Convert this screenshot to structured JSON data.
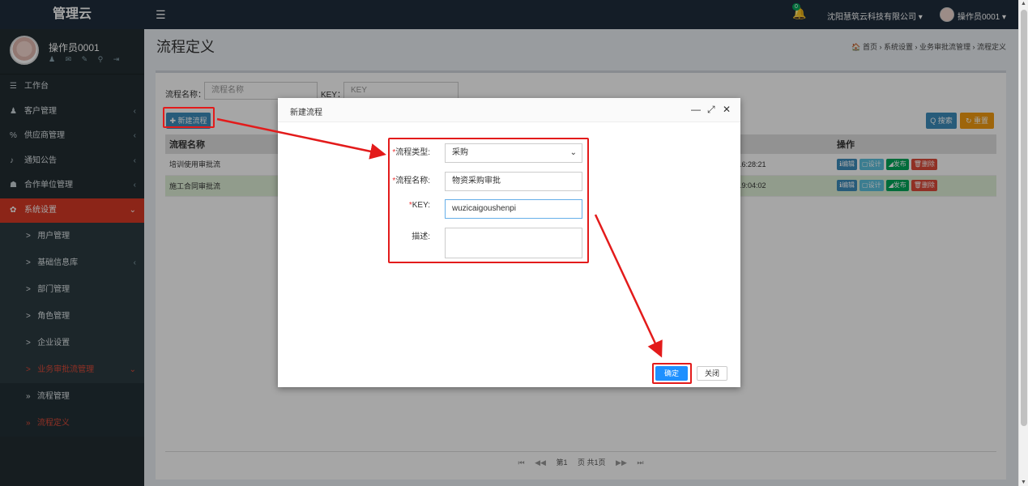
{
  "sidebar": {
    "brand": "管理云",
    "user_name": "操作员0001",
    "menu": [
      {
        "label": "工作台",
        "icon": "dashboard-icon",
        "glyph": "☰",
        "arrow": ""
      },
      {
        "label": "客户管理",
        "icon": "user-icon",
        "glyph": "♟",
        "arrow": "‹"
      },
      {
        "label": "供应商管理",
        "icon": "link-icon",
        "glyph": "%",
        "arrow": "‹"
      },
      {
        "label": "通知公告",
        "icon": "microphone-icon",
        "glyph": "♪",
        "arrow": "‹"
      },
      {
        "label": "合作单位管理",
        "icon": "group-icon",
        "glyph": "☗",
        "arrow": "‹"
      },
      {
        "label": "系统设置",
        "icon": "gear-icon",
        "glyph": "✿",
        "arrow": "⌄"
      }
    ],
    "submenu": [
      {
        "label": "用户管理",
        "prefix": ">",
        "arrow": ""
      },
      {
        "label": "基础信息库",
        "prefix": ">",
        "arrow": "‹"
      },
      {
        "label": "部门管理",
        "prefix": ">",
        "arrow": ""
      },
      {
        "label": "角色管理",
        "prefix": ">",
        "arrow": ""
      },
      {
        "label": "企业设置",
        "prefix": ">",
        "arrow": ""
      },
      {
        "label": "业务审批流管理",
        "prefix": ">",
        "arrow": "⌄"
      },
      {
        "label": "流程管理",
        "prefix": "»",
        "arrow": ""
      },
      {
        "label": "流程定义",
        "prefix": "»",
        "arrow": ""
      }
    ]
  },
  "topbar": {
    "notification_count": "0",
    "company": "沈阳慧筑云科技有限公司 ▾",
    "operator": "操作员0001 ▾"
  },
  "header": {
    "title": "流程定义",
    "breadcrumb": "🏠 首页 › 系统设置 › 业务审批流管理 › 流程定义"
  },
  "filters": {
    "name_label": "流程名称：",
    "name_placeholder": "流程名称",
    "key_label": "KEY：",
    "key_placeholder": "KEY",
    "new_button": "✚ 新建流程",
    "search_button": "Q 搜索",
    "reset_button": "↻ 重置"
  },
  "table": {
    "columns": [
      "流程名称",
      "",
      "操作"
    ],
    "rows": [
      {
        "name": "培训使用审批流",
        "time": "1 16:28:21"
      },
      {
        "name": "施工合同审批流",
        "time": "1 19:04:02"
      }
    ],
    "actions": {
      "edit": "ℹ编辑",
      "design": "▢设计",
      "publish": "◢发布",
      "delete": "🗑删除"
    }
  },
  "pager": {
    "first": "⏮",
    "prev": "◀◀",
    "page_prefix": "第1",
    "page_suffix": "页 共1页",
    "next": "▶▶",
    "last": "⏭"
  },
  "dialog": {
    "title": "新建流程",
    "minimize": "—",
    "maximize": "⤢",
    "close": "✕",
    "fields": {
      "type_label": "流程类型:",
      "type_value": "采购",
      "name_label": "流程名称:",
      "name_value": "物资采购审批",
      "key_label": "KEY:",
      "key_value": "wuzicaigoushenpi",
      "desc_label": "描述:"
    },
    "confirm": "确定",
    "close_button": "关闭"
  },
  "colors": {
    "sidebar_bg": "#222d32",
    "active_red": "#d73925",
    "annotation_red": "#e31b1b",
    "primary_blue": "#1e90ff"
  }
}
